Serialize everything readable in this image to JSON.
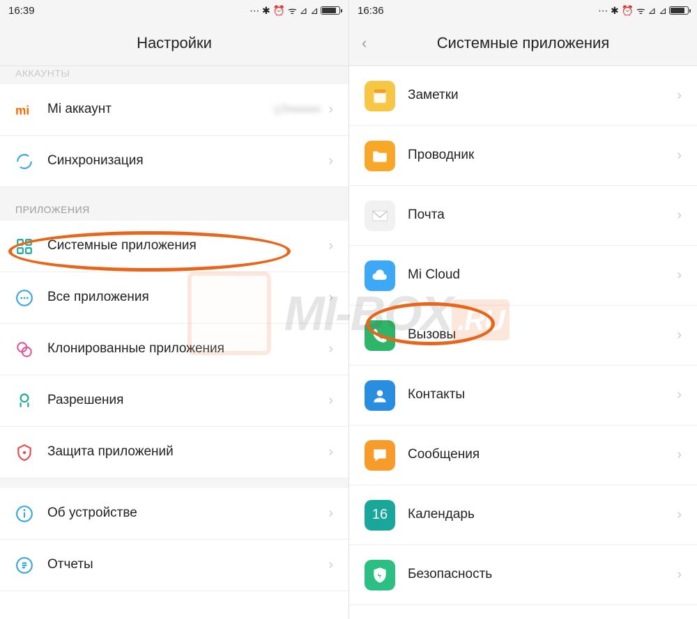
{
  "left": {
    "time": "16:39",
    "title": "Настройки",
    "sections": {
      "accounts": {
        "header_truncated": "АККАУНТЫ",
        "items": [
          {
            "label": "Mi аккаунт",
            "value": "17••••••••",
            "icon": "mi-logo-icon"
          },
          {
            "label": "Синхронизация",
            "icon": "sync-icon"
          }
        ]
      },
      "apps": {
        "header": "ПРИЛОЖЕНИЯ",
        "items": [
          {
            "label": "Системные приложения",
            "icon": "apps-grid-icon",
            "highlight": true
          },
          {
            "label": "Все приложения",
            "icon": "more-circle-icon"
          },
          {
            "label": "Клонированные приложения",
            "icon": "clone-icon"
          },
          {
            "label": "Разрешения",
            "icon": "permissions-icon"
          },
          {
            "label": "Защита приложений",
            "icon": "app-lock-icon"
          }
        ]
      },
      "other": {
        "items": [
          {
            "label": "Об устройстве",
            "icon": "info-icon"
          },
          {
            "label": "Отчеты",
            "icon": "reports-icon"
          }
        ]
      }
    }
  },
  "right": {
    "time": "16:36",
    "title": "Системные приложения",
    "items": [
      {
        "label": "Заметки",
        "icon": "notes-icon",
        "bg": "#f8c645"
      },
      {
        "label": "Проводник",
        "icon": "explorer-icon",
        "bg": "#f7a829"
      },
      {
        "label": "Почта",
        "icon": "mail-icon",
        "bg": "#f1f1f1"
      },
      {
        "label": "Mi Cloud",
        "icon": "cloud-icon",
        "bg": "#3da8f5"
      },
      {
        "label": "Вызовы",
        "icon": "phone-icon",
        "bg": "#2fb56a",
        "highlight": true
      },
      {
        "label": "Контакты",
        "icon": "contacts-icon",
        "bg": "#2a8ee0"
      },
      {
        "label": "Сообщения",
        "icon": "messages-icon",
        "bg": "#f79c2a"
      },
      {
        "label": "Календарь",
        "icon": "calendar-icon",
        "bg": "#1aa79b",
        "text": "16"
      },
      {
        "label": "Безопасность",
        "icon": "security-icon",
        "bg": "#2cbf84"
      }
    ]
  },
  "watermark": {
    "text": "MI-BOX",
    "suffix": ".RU"
  }
}
